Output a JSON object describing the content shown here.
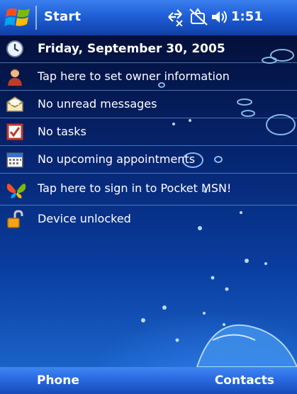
{
  "title_bar": {
    "title": "Start",
    "time": "1:51",
    "icons": [
      "windows-flag-icon",
      "connectivity-icon",
      "phone-off-icon",
      "volume-icon"
    ]
  },
  "today": {
    "date": "Friday, September 30, 2005",
    "owner": "Tap here to set owner information",
    "messages": "No unread messages",
    "tasks": "No tasks",
    "appointments": "No upcoming appointments",
    "msn": "Tap here to sign in to Pocket MSN!",
    "lock": "Device unlocked"
  },
  "softkeys": {
    "left": "Phone",
    "right": "Contacts"
  },
  "colors": {
    "titlebar": "#1f5fd6",
    "background_top": "#03103a",
    "background_bottom": "#1a62c8",
    "divider": "#78beff",
    "text": "#ffffff"
  }
}
